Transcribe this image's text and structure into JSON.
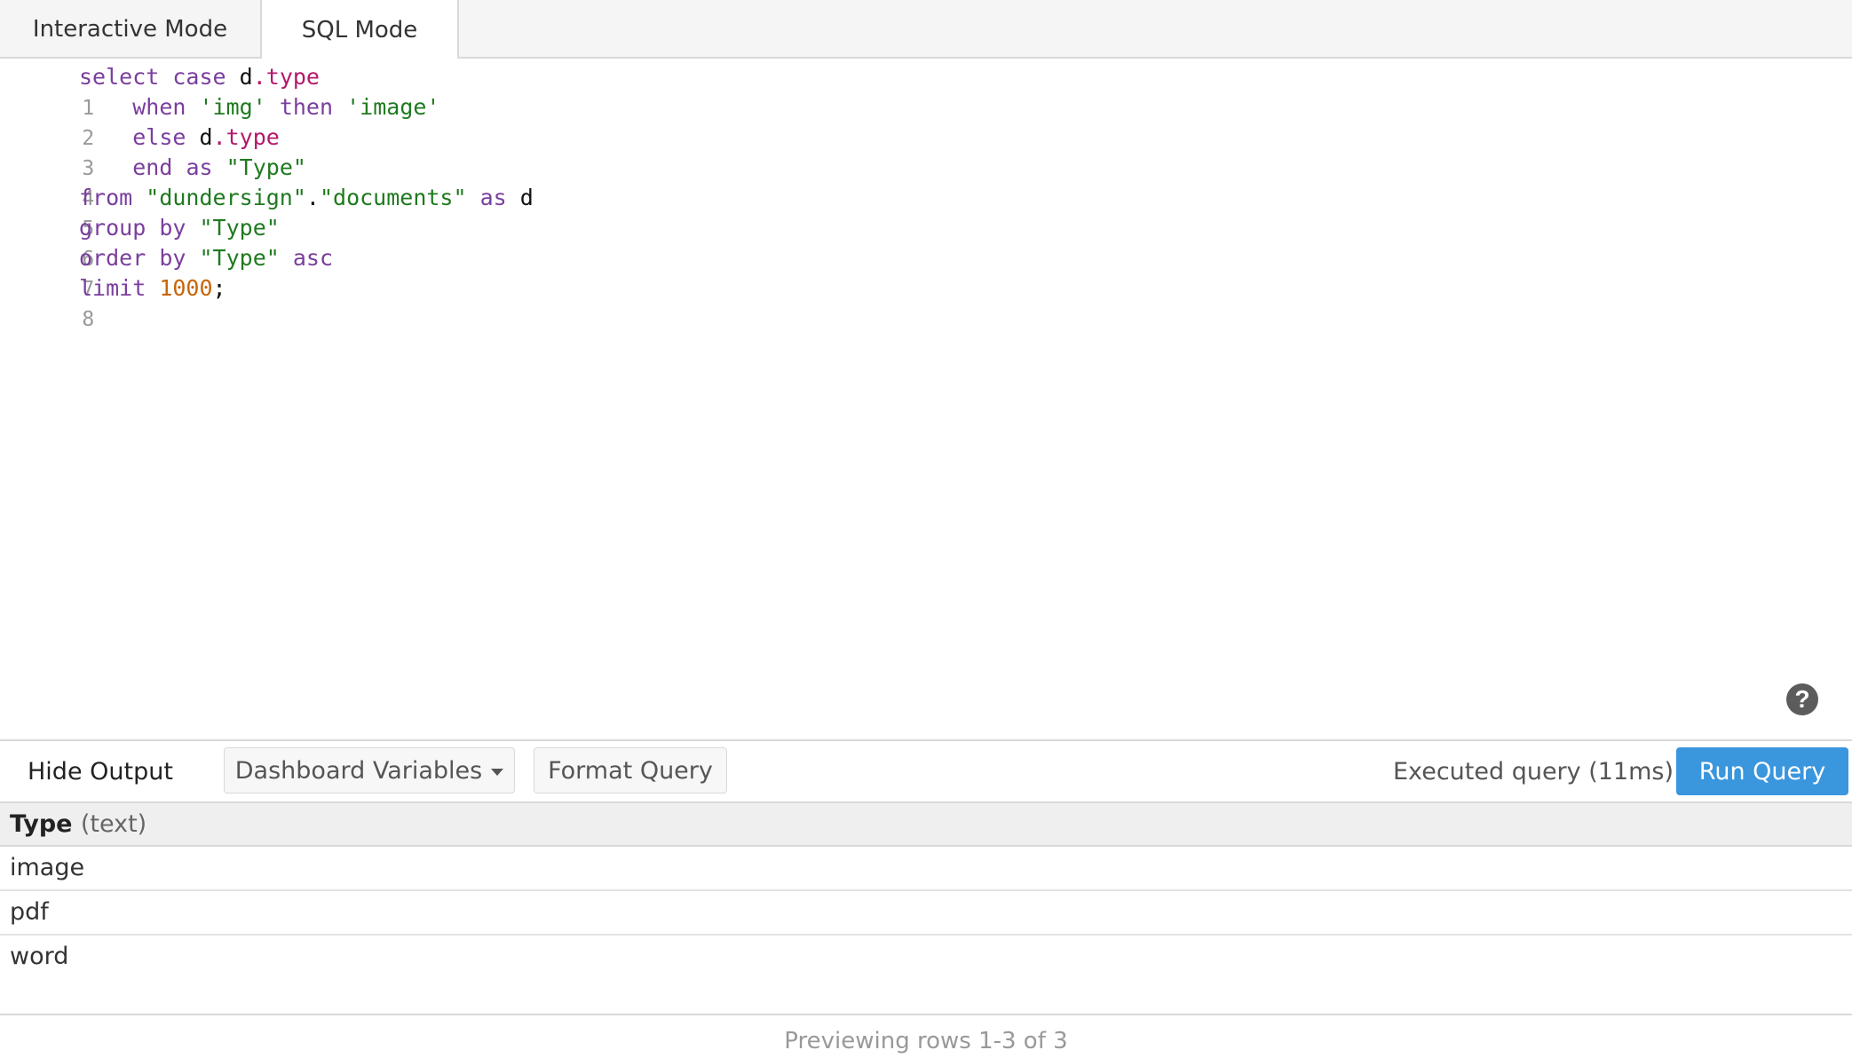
{
  "tabs": [
    {
      "label": "Interactive Mode",
      "active": false
    },
    {
      "label": "SQL Mode",
      "active": true
    }
  ],
  "editor": {
    "line_numbers": [
      "1",
      "2",
      "3",
      "4",
      "5",
      "6",
      "7",
      "8"
    ],
    "tokens": {
      "l1": [
        "select",
        "case",
        "d",
        ".type"
      ],
      "l2": [
        "when",
        "'img'",
        "then",
        "'image'"
      ],
      "l3": [
        "else",
        "d",
        ".type"
      ],
      "l4": [
        "end",
        "as",
        "\"Type\""
      ],
      "l5": [
        "from",
        "\"dundersign\"",
        ".",
        "\"documents\"",
        "as",
        "d"
      ],
      "l6": [
        "group",
        "by",
        "\"Type\""
      ],
      "l7": [
        "order",
        "by",
        "\"Type\"",
        "asc"
      ],
      "l8": [
        "limit",
        "1000",
        ";"
      ]
    },
    "colors": {
      "keyword": "#7a3e9d",
      "property": "#b3186a",
      "string": "#1f7a1f",
      "number": "#c7650b"
    }
  },
  "help": {
    "glyph": "?"
  },
  "toolbar": {
    "hide_output": "Hide Output",
    "dashboard_variables": "Dashboard Variables",
    "format_query": "Format Query",
    "status": "Executed query (11ms)",
    "run_query": "Run Query",
    "run_color": "#3a96dd"
  },
  "results": {
    "column": {
      "name": "Type",
      "type": "(text)"
    },
    "rows": [
      "image",
      "pdf",
      "word"
    ],
    "preview": "Previewing rows 1-3 of 3"
  }
}
